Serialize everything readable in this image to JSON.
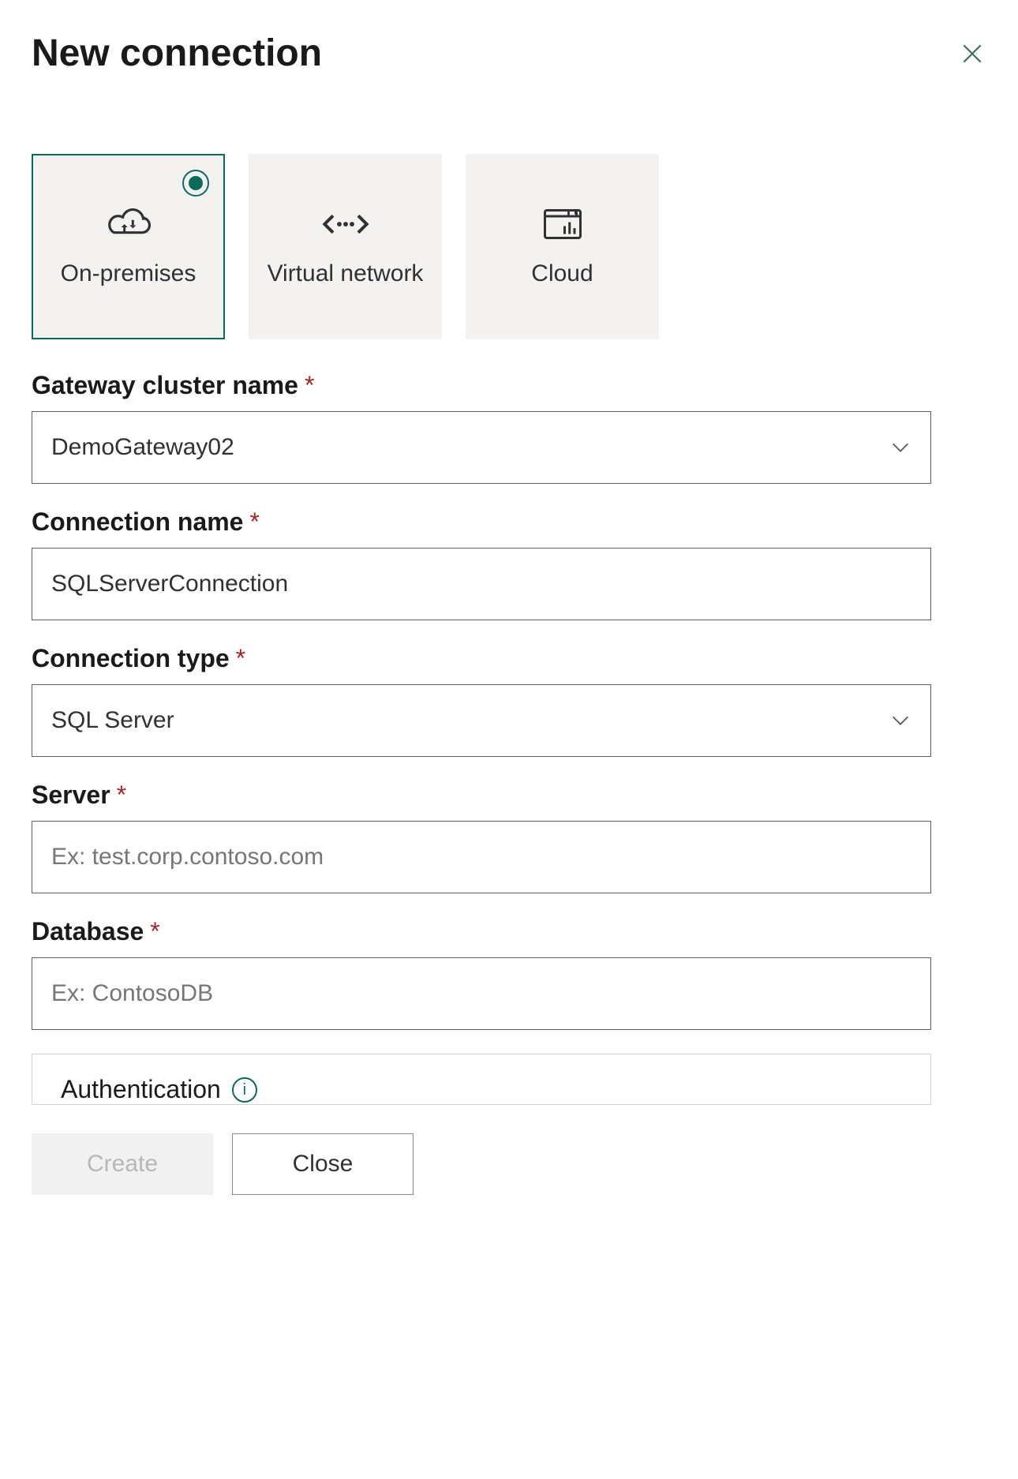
{
  "header": {
    "title": "New connection"
  },
  "conn_types": {
    "on_prem": "On-premises",
    "vnet": "Virtual network",
    "cloud": "Cloud"
  },
  "fields": {
    "gateway": {
      "label": "Gateway cluster name",
      "value": "DemoGateway02"
    },
    "conn_name": {
      "label": "Connection name",
      "value": "SQLServerConnection"
    },
    "conn_type": {
      "label": "Connection type",
      "value": "SQL Server"
    },
    "server": {
      "label": "Server",
      "placeholder": "Ex: test.corp.contoso.com",
      "value": ""
    },
    "database": {
      "label": "Database",
      "placeholder": "Ex: ContosoDB",
      "value": ""
    }
  },
  "auth": {
    "title": "Authentication"
  },
  "footer": {
    "create": "Create",
    "close": "Close"
  },
  "required_marker": "*"
}
